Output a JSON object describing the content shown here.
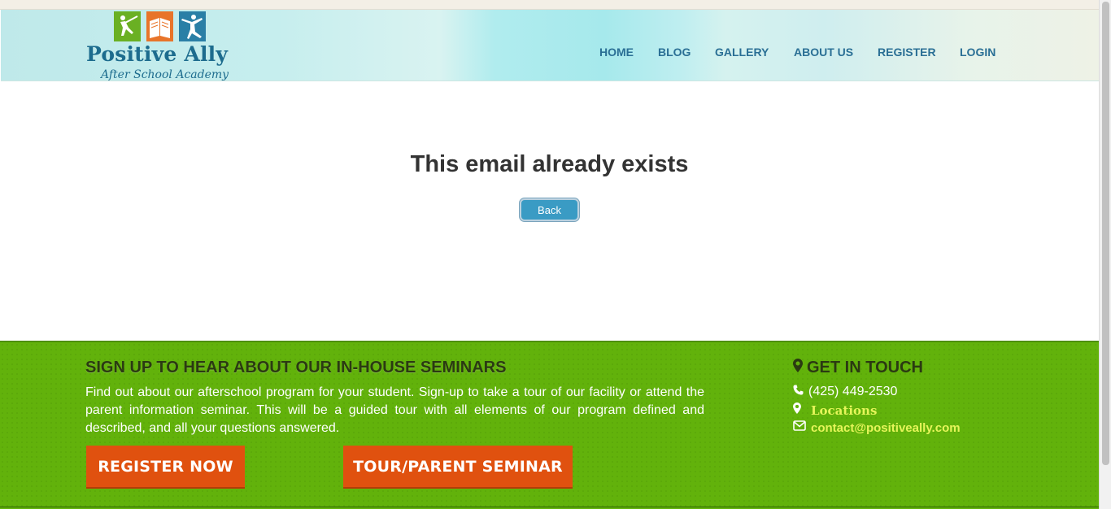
{
  "brand": {
    "name": "Positive Ally",
    "tagline": "After School Academy",
    "icon_colors": [
      "#6ab023",
      "#e8742a",
      "#2a7fa6"
    ]
  },
  "nav": {
    "items": [
      {
        "label": "HOME"
      },
      {
        "label": "BLOG"
      },
      {
        "label": "GALLERY"
      },
      {
        "label": "ABOUT US"
      },
      {
        "label": "REGISTER"
      },
      {
        "label": "LOGIN"
      }
    ]
  },
  "main": {
    "message": "This email already exists",
    "back_label": "Back"
  },
  "footer": {
    "seminar_title": "SIGN UP TO HEAR ABOUT OUR IN-HOUSE SEMINARS",
    "seminar_text": "Find out about our afterschool program for your student. Sign-up to take a tour of our facility or attend the parent information seminar. This will be a guided tour with all elements of our program defined and described, and all your questions answered.",
    "register_label": "REGISTER NOW",
    "tour_label": "TOUR/PARENT SEMINAR",
    "contact_title": "GET IN TOUCH",
    "phone": "(425) 449-2530",
    "locations_label": "Locations",
    "email": "contact@positiveally.com"
  },
  "colors": {
    "footer_green": "#62b20b",
    "cta_orange": "#e0510f",
    "link_yellow": "#e6f55a",
    "nav_blue": "#2a6f95",
    "button_blue": "#3a9bc4"
  }
}
